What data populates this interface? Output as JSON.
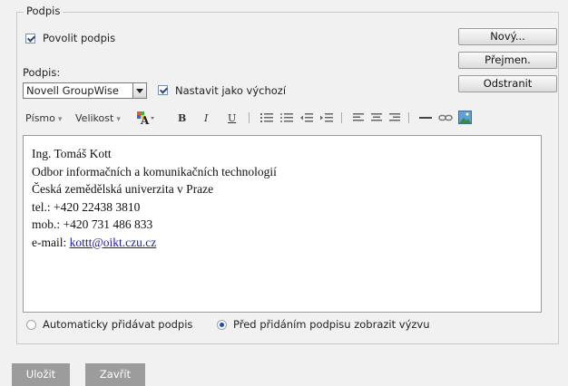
{
  "group_label": "Podpis",
  "enable_signature": {
    "label": "Povolit podpis",
    "checked": true
  },
  "buttons": {
    "new": "Nový...",
    "rename": "Přejmen.",
    "remove": "Odstranit"
  },
  "signature_label": "Podpis:",
  "signature_select": {
    "value": "Novell GroupWise"
  },
  "set_default": {
    "label": "Nastavit jako výchozí",
    "checked": true
  },
  "toolbar": {
    "font": "Písmo",
    "size": "Velikost",
    "bold": "B",
    "italic": "I",
    "underline": "U"
  },
  "editor": {
    "lines": [
      "Ing. Tomáš Kott",
      "Odbor informačních a komunikačních technologií",
      "Česká zemědělská univerzita v Praze",
      "tel.: +420 22438 3810",
      "mob.: +420 731 486 833"
    ],
    "email_prefix": "e-mail: ",
    "email": "kottt@oikt.czu.cz"
  },
  "radios": {
    "auto": {
      "label": "Automaticky přidávat podpis",
      "selected": false
    },
    "prompt": {
      "label": "Před přidáním podpisu zobrazit výzvu",
      "selected": true
    }
  },
  "footer": {
    "save": "Uložit",
    "close": "Zavřít"
  },
  "colors": {
    "background": "#f1f1f1",
    "footer_button": "#9c9c9c",
    "link": "#1a1aa6"
  }
}
